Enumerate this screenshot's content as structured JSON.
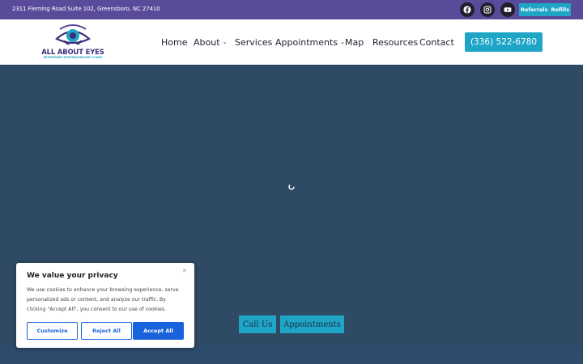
{
  "topbar": {
    "address": "2311 Fleming Road Suite 102, Greensboro, NC 27410",
    "social": [
      "facebook-icon",
      "instagram-icon",
      "youtube-icon"
    ],
    "links": [
      "Referrals",
      "Refills"
    ]
  },
  "logo": {
    "name": "ALL ABOUT EYES",
    "tagline": "VETERINARY OPHTHALMOLOGY CLINIC"
  },
  "nav": {
    "items": [
      {
        "label": "Home"
      },
      {
        "label": "About",
        "dropdown": true
      },
      {
        "label": "Services"
      },
      {
        "label": "Appointments",
        "dropdown": true
      },
      {
        "label": "Map"
      },
      {
        "label": "Resources"
      },
      {
        "label": "Contact"
      }
    ],
    "phone": "(336) 522-6780"
  },
  "hero": {
    "buttons": [
      "Call Us",
      "Appointments"
    ]
  },
  "cookie": {
    "title": "We value your privacy",
    "close": "×",
    "text": "We use cookies to enhance your browsing experience, serve personalized ads or content, and analyze our traffic. By clicking \"Accept All\", you consent to our use of cookies.",
    "buttons": {
      "customize": "Customize",
      "reject": "Reject All",
      "accept": "Accept All"
    }
  },
  "colors": {
    "topbar": "#5a4a9a",
    "accent": "#1fa6c7",
    "hero": "#2e4a64",
    "cookie_button": "#1863dc"
  }
}
